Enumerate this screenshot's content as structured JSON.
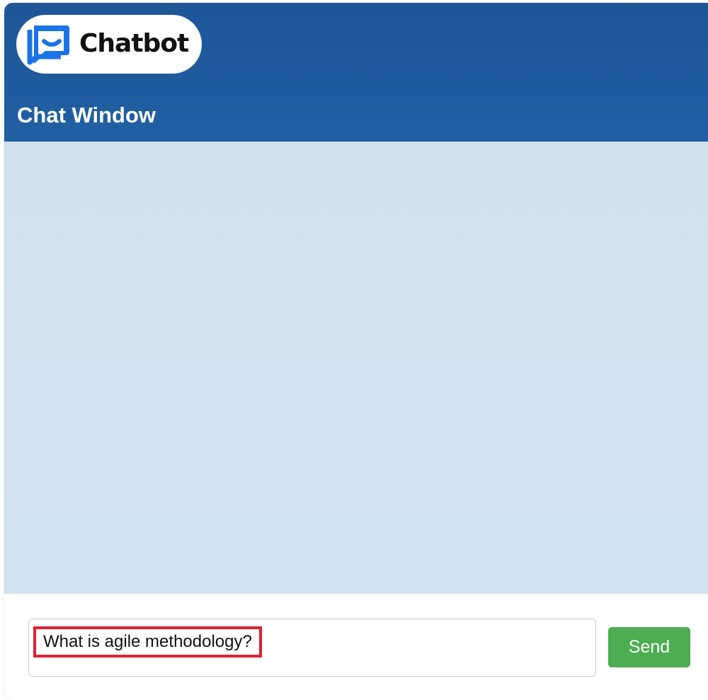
{
  "header": {
    "logo_text": "Chatbot",
    "window_title": "Chat Window"
  },
  "composer": {
    "input_value": "What is agile methodology?",
    "send_label": "Send"
  },
  "icons": {
    "logo": "chat-bubble-smile-icon"
  },
  "colors": {
    "header_blue": "#1e5698",
    "logo_blue": "#1a73e8",
    "chat_area": "#d3e1ec",
    "send_green": "#4cae50",
    "highlight_red": "#e0212e"
  }
}
